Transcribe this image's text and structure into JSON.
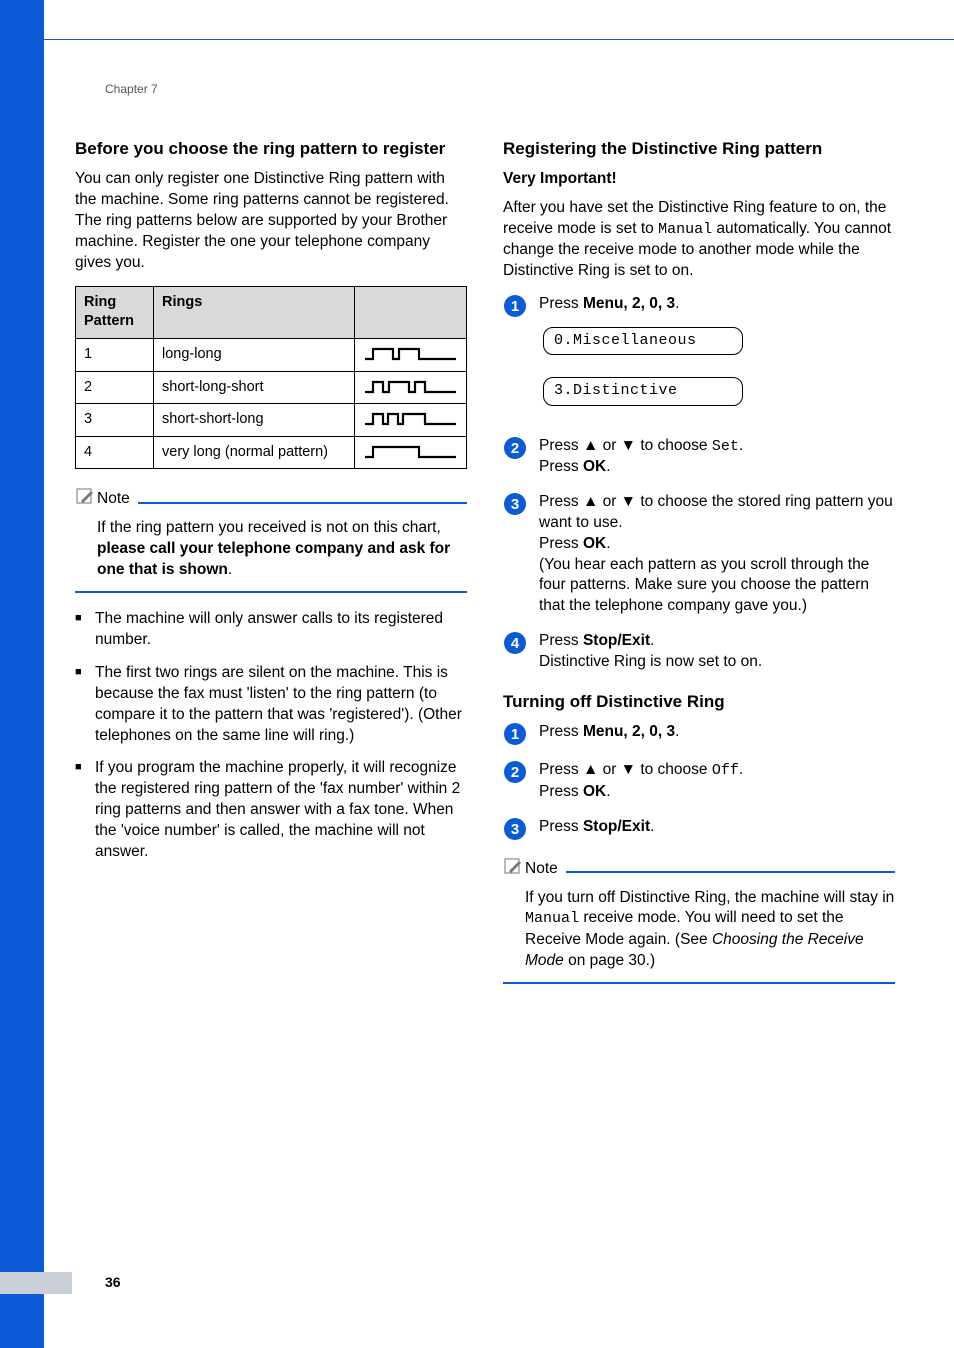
{
  "chapter": "Chapter 7",
  "page_number": "36",
  "left": {
    "h3": "Before you choose the ring pattern to register",
    "intro": "You can only register one Distinctive Ring pattern with the machine. Some ring patterns cannot be registered. The ring patterns below are supported by your Brother machine. Register the one your telephone company gives you.",
    "table": {
      "head": {
        "c1": "Ring Pattern",
        "c2": "Rings",
        "c3": ""
      },
      "rows": [
        {
          "c1": "1",
          "c2": "long-long"
        },
        {
          "c1": "2",
          "c2": "short-long-short"
        },
        {
          "c1": "3",
          "c2": "short-short-long"
        },
        {
          "c1": "4",
          "c2": "very long (normal pattern)"
        }
      ]
    },
    "note_label": "Note",
    "note_body_pre": "If the ring pattern you received is not on this chart, ",
    "note_body_bold": "please call your telephone company and ask for one that is shown",
    "note_body_post": ".",
    "bullets": [
      "The machine will only answer calls to its registered number.",
      "The first two rings are silent on the machine. This is because the fax must 'listen' to the ring pattern (to compare it to the pattern that was 'registered'). (Other telephones on the same line will ring.)",
      "If you program the machine properly, it will recognize the registered ring pattern of the 'fax number' within 2 ring patterns and then answer with a fax tone. When the 'voice number' is called, the machine will not answer."
    ]
  },
  "right": {
    "h3": "Registering the Distinctive Ring pattern",
    "very_important": "Very Important!",
    "intro_pre": "After you have set the Distinctive Ring feature to on, the receive mode is set to ",
    "intro_mono": "Manual",
    "intro_post": " automatically. You cannot change the receive mode to another mode while the Distinctive Ring is set to on.",
    "step1_pre": "Press ",
    "step1_bold": "Menu",
    "step1_seq": ", 2, 0, 3",
    "lcd1": "0.Miscellaneous",
    "lcd2": "3.Distinctive",
    "step2_pre": "Press ",
    "step2_arrows": "▲ or ▼",
    "step2_mid": " to choose ",
    "step2_mono": "Set",
    "step2_post": ".",
    "press_ok_pre": "Press ",
    "press_ok_bold": "OK",
    "press_ok_post": ".",
    "step3_a_pre": "Press ",
    "step3_a_arr": "▲ or ▼",
    "step3_a_post": " to choose the stored ring pattern you want to use.",
    "step3_b_pre": "Press ",
    "step3_b_bold": "OK",
    "step3_b_post": ".",
    "step3_c": "(You hear each pattern as you scroll through the four patterns. Make sure you choose the pattern that the telephone company gave you.)",
    "step4_pre": "Press ",
    "step4_bold": "Stop/Exit",
    "step4_post": ".",
    "step4_line2": "Distinctive Ring is now set to on.",
    "h3b": "Turning off Distinctive Ring",
    "b_step1_pre": "Press ",
    "b_step1_bold": "Menu",
    "b_step1_seq": ", 2, 0, 3",
    "b_step2_pre": "Press ",
    "b_step2_arr": "▲ or ▼",
    "b_step2_mid": " to choose ",
    "b_step2_mono": "Off",
    "b_step2_post": ".",
    "b_step2_ok_pre": "Press ",
    "b_step2_ok_bold": "OK",
    "b_step2_ok_post": ".",
    "b_step3_pre": "Press ",
    "b_step3_bold": "Stop/Exit",
    "b_step3_post": ".",
    "note_label": "Note",
    "note2_pre": "If you turn off Distinctive Ring, the machine will stay in ",
    "note2_mono": "Manual",
    "note2_mid": " receive mode. You will need to set the Receive Mode again. (See ",
    "note2_italic": "Choosing the Receive Mode",
    "note2_post": " on page 30.)"
  }
}
